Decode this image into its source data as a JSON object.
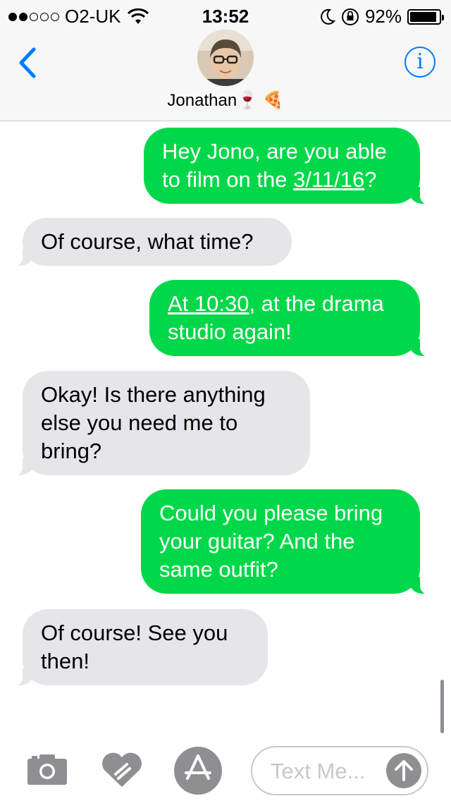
{
  "status_bar": {
    "carrier": "O2-UK",
    "time": "13:52",
    "battery": "92%",
    "battery_level": 0.92
  },
  "header": {
    "contact_name": "Jonathan🍷 🍕",
    "back_icon": "chevron-left-icon",
    "info_icon": "info-icon",
    "info_label": "i"
  },
  "messages": [
    {
      "direction": "outgoing",
      "parts": [
        {
          "text": "Hey Jono, are you able to film on the "
        },
        {
          "text": "3/11/16",
          "link": true
        },
        {
          "text": "?"
        }
      ]
    },
    {
      "direction": "incoming",
      "text": "Of course, what time?"
    },
    {
      "direction": "outgoing",
      "parts": [
        {
          "text": "At 10:30",
          "link": true
        },
        {
          "text": ", at the drama studio again!"
        }
      ]
    },
    {
      "direction": "incoming",
      "text": "Okay! Is there anything else you need me to bring?"
    },
    {
      "direction": "outgoing",
      "text": "Could you please bring your guitar? And the same outfit?"
    },
    {
      "direction": "incoming",
      "text": "Of course! See you then!"
    }
  ],
  "input_bar": {
    "placeholder": "Text Me...",
    "camera_icon": "camera-icon",
    "digital_touch_icon": "digital-touch-heart-icon",
    "apps_icon": "app-store-icon",
    "send_icon": "send-arrow-up-icon"
  },
  "colors": {
    "outgoing_bubble": "#00d84a",
    "incoming_bubble": "#e5e5ea",
    "accent": "#007aff"
  }
}
